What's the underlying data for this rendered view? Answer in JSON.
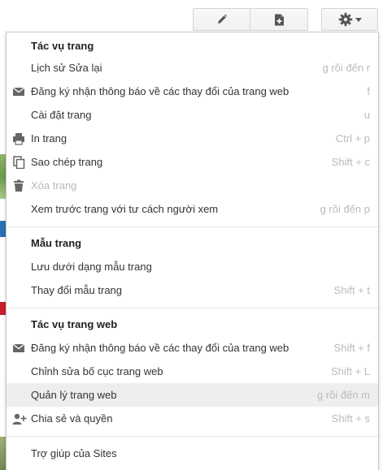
{
  "toolbar": {
    "edit_icon": "pencil-icon",
    "new_page_icon": "new-page-icon",
    "more_icon": "gear-icon"
  },
  "menu": {
    "page_actions": {
      "title": "Tác vụ trang",
      "items": [
        {
          "label": "Lịch sử Sửa lại",
          "shortcut": "g rồi đến r"
        },
        {
          "label": "Đăng ký nhận thông báo về các thay đổi của trang web",
          "shortcut": "f"
        },
        {
          "label": "Cài đặt trang",
          "shortcut": "u"
        },
        {
          "label": "In trang",
          "shortcut": "Ctrl + p"
        },
        {
          "label": "Sao chép trang",
          "shortcut": "Shift + c"
        },
        {
          "label": "Xóa trang",
          "shortcut": ""
        },
        {
          "label": "Xem trước trang với tư cách người xem",
          "shortcut": "g rồi đến p"
        }
      ]
    },
    "page_templates": {
      "title": "Mẫu trang",
      "items": [
        {
          "label": "Lưu dưới dạng mẫu trang",
          "shortcut": ""
        },
        {
          "label": "Thay đổi mẫu trang",
          "shortcut": "Shift + t"
        }
      ]
    },
    "site_actions": {
      "title": "Tác vụ trang web",
      "items": [
        {
          "label": "Đăng ký nhận thông báo về các thay đổi của trang web",
          "shortcut": "Shift + f"
        },
        {
          "label": "Chỉnh sửa bố cục trang web",
          "shortcut": "Shift + L"
        },
        {
          "label": "Quản lý trang web",
          "shortcut": "g rồi đến m"
        },
        {
          "label": "Chia sẻ và quyền",
          "shortcut": "Shift + s"
        }
      ]
    },
    "help": {
      "label": "Trợ giúp của Sites"
    }
  },
  "colors": {
    "hover_bg": "#eeeeee",
    "shortcut_text": "#bbbbbb",
    "disabled_text": "#b8b8b8"
  }
}
